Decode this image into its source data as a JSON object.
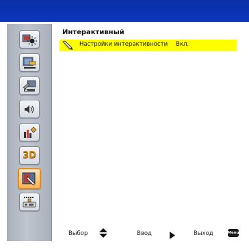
{
  "section": {
    "title": "Интерактивный"
  },
  "rows": [
    {
      "label": "Настройки интерактивности",
      "value": "Вкл."
    }
  ],
  "sidebar": {
    "items": [
      {
        "icon": "image-settings-icon",
        "label": ""
      },
      {
        "icon": "display-settings-icon",
        "label": ""
      },
      {
        "icon": "setup-icon",
        "label": ""
      },
      {
        "icon": "volume-icon",
        "label": ""
      },
      {
        "icon": "options-icon",
        "label": ""
      },
      {
        "icon": "3d-icon",
        "label": "3D"
      },
      {
        "icon": "interactive-icon",
        "label": ""
      },
      {
        "icon": "lan-icon",
        "label": ""
      }
    ],
    "active_index": 6
  },
  "footer": {
    "select_label": "Выбор",
    "enter_label": "Ввод",
    "exit_label": "Выход",
    "menu_key": "Menu"
  },
  "colors": {
    "top_bar": "#0b35bb",
    "highlight": "#ffff00",
    "active_border": "#e88a1a"
  }
}
